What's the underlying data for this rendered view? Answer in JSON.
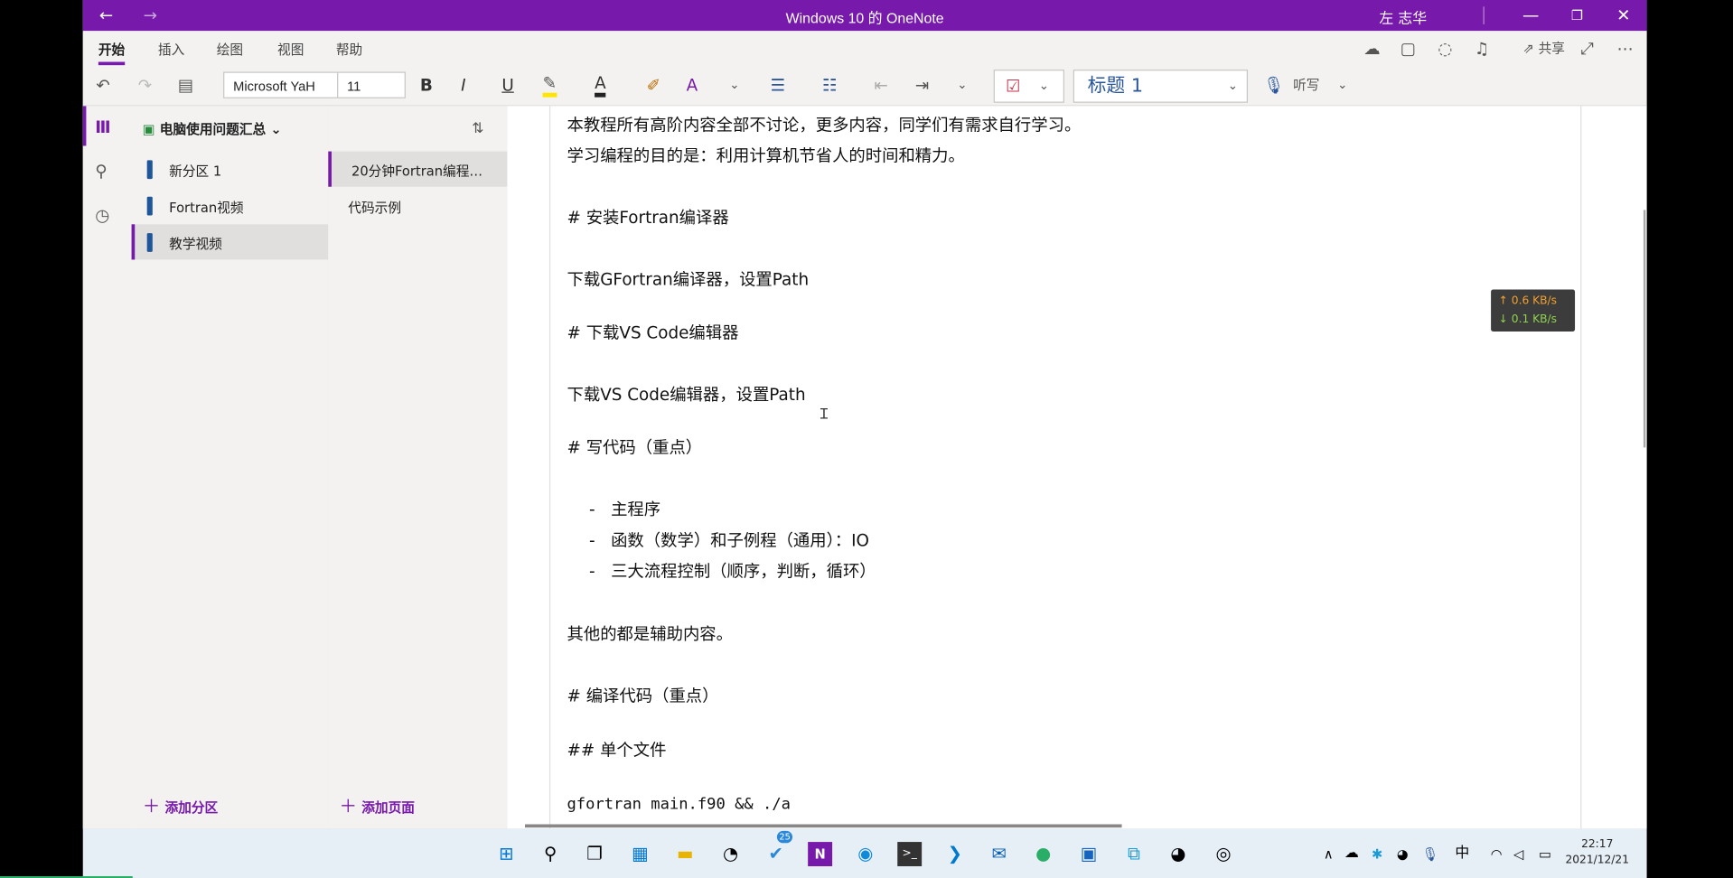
{
  "window": {
    "title": "Windows 10 的 OneNote",
    "user": "左 志华"
  },
  "ribbon": {
    "tabs": [
      "开始",
      "插入",
      "绘图",
      "视图",
      "帮助"
    ],
    "share_label": "共享"
  },
  "toolbar": {
    "font_name": "Microsoft YaH",
    "font_size": "11",
    "style": "标题 1",
    "dictate_label": "听写"
  },
  "notebook": {
    "name": "电脑使用问题汇总"
  },
  "sections": [
    {
      "label": "新分区 1"
    },
    {
      "label": "Fortran视频"
    },
    {
      "label": "教学视频"
    }
  ],
  "pages": [
    {
      "label": "20分钟Fortran编程入..."
    },
    {
      "label": "代码示例"
    }
  ],
  "add_section": "添加分区",
  "add_page": "添加页面",
  "content": {
    "l1": "本教程所有高阶内容全部不讨论，更多内容，同学们有需求自行学习。",
    "l2": "学习编程的目的是：利用计算机节省人的时间和精力。",
    "l3": "# 安装Fortran编译器",
    "l4": "下载GFortran编译器，设置Path",
    "l5": "# 下载VS Code编辑器",
    "l6": "下载VS Code编辑器，设置Path",
    "l7": "# 写代码（重点）",
    "b1": "主程序",
    "b2": "函数（数学）和子例程（通用）：IO",
    "b3": "三大流程控制（顺序，判断，循环）",
    "l8": "其他的都是辅助内容。",
    "l9": "# 编译代码（重点）",
    "l10": "## 单个文件",
    "l11": "gfortran main.f90 && ./a"
  },
  "net": {
    "up": "↑ 0.6 KB/s",
    "down": "↓ 0.1 KB/s",
    "up_color": "#f0a030",
    "down_color": "#8fd14f"
  },
  "taskbar": {
    "badge": "25",
    "ime": "中",
    "time": "22:17",
    "date": "2021/12/21"
  }
}
